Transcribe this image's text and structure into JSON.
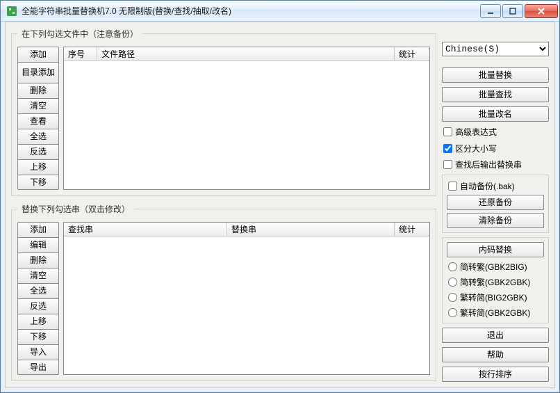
{
  "window": {
    "title": "全能字符串批量替换机7.0 无限制版(替换/查找/抽取/改名)"
  },
  "group1": {
    "legend": "在下列勾选文件中（注意备份）",
    "buttons": [
      "添加",
      "目录添加",
      "删除",
      "清空",
      "查看",
      "全选",
      "反选",
      "上移",
      "下移"
    ],
    "columns": {
      "c0": "序号",
      "c1": "文件路径",
      "c2": "统计"
    }
  },
  "group2": {
    "legend": "替换下列勾选串（双击修改）",
    "buttons": [
      "添加",
      "编辑",
      "删除",
      "清空",
      "全选",
      "反选",
      "上移",
      "下移",
      "导入",
      "导出"
    ],
    "columns": {
      "c0": "查找串",
      "c1": "替换串",
      "c2": "统计"
    }
  },
  "right": {
    "lang_selected": "Chinese(S)",
    "btn_replace": "批量替换",
    "btn_find": "批量查找",
    "btn_rename": "批量改名",
    "chk_adv": "高级表达式",
    "chk_case": "区分大小写",
    "chk_output": "查找后输出替换串",
    "chk_backup": "自动备份(.bak)",
    "btn_restore": "还原备份",
    "btn_clearbak": "清除备份",
    "btn_encode": "内码替换",
    "radio1": "简转繁(GBK2BIG)",
    "radio2": "简转繁(GBK2GBK)",
    "radio3": "繁转简(BIG2GBK)",
    "radio4": "繁转简(GBK2GBK)",
    "btn_exit": "退出",
    "btn_help": "帮助",
    "btn_sort": "按行排序"
  }
}
